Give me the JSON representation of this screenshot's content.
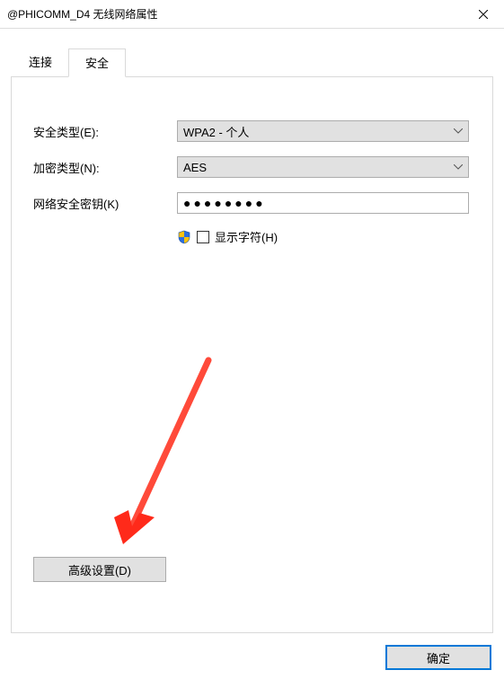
{
  "window": {
    "title": "@PHICOMM_D4 无线网络属性"
  },
  "tabs": {
    "connect": "连接",
    "security": "安全"
  },
  "labels": {
    "security_type": "安全类型(E):",
    "encryption_type": "加密类型(N):",
    "network_key": "网络安全密钥(K)",
    "show_chars": "显示字符(H)"
  },
  "values": {
    "security_type": "WPA2 - 个人",
    "encryption_type": "AES",
    "network_key": "●●●●●●●●"
  },
  "buttons": {
    "advanced": "高级设置(D)",
    "ok": "确定"
  }
}
